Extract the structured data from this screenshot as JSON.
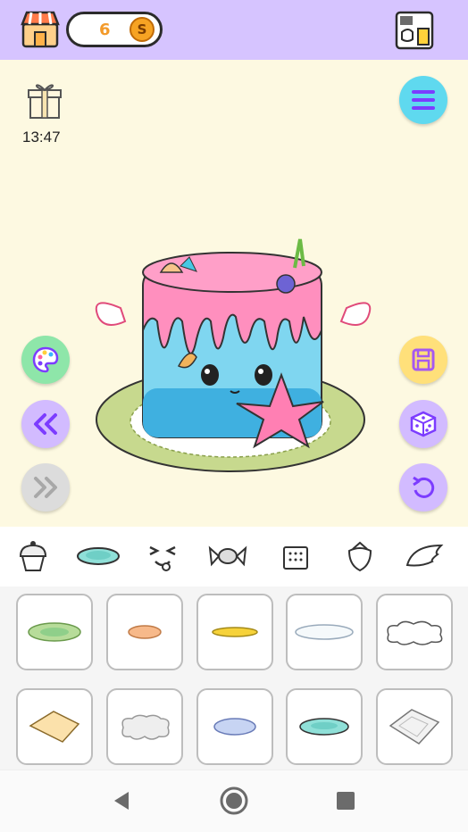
{
  "header": {
    "coins": "6",
    "coin_symbol": "S"
  },
  "gift": {
    "timer": "13:47"
  },
  "side_buttons": {
    "left": [
      "palette-icon",
      "double-chevron-left-icon",
      "double-chevron-right-icon"
    ],
    "right": [
      "menu-icon",
      "save-icon",
      "dice-icon",
      "undo-icon"
    ]
  },
  "category_tabs": [
    "cupcake-icon",
    "plate-icon",
    "face-icon",
    "candy-icon",
    "cracker-icon",
    "strawberry-icon",
    "wing-icon"
  ],
  "selected_tab": "plate-icon",
  "items": [
    "green-plate",
    "orange-plate",
    "gold-plate",
    "white-plate",
    "cloud-outline",
    "parchment-paper",
    "cloud-paper",
    "blue-plate",
    "teal-plate",
    "doily-paper"
  ],
  "nav": [
    "back-icon",
    "home-icon",
    "recents-icon"
  ],
  "colors": {
    "topbar": "#d6c4ff",
    "canvas": "#fdf9e1",
    "accent_orange": "#f39a2a"
  }
}
